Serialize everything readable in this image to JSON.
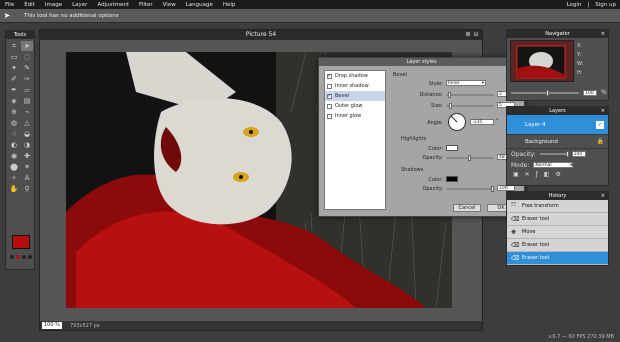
{
  "menu": [
    "File",
    "Edit",
    "Image",
    "Layer",
    "Adjustment",
    "Filter",
    "View",
    "Language",
    "Help"
  ],
  "account": {
    "login": "Login",
    "signup": "Sign up"
  },
  "infobar": {
    "text": "This tool has no additional options"
  },
  "tools_panel": {
    "title": "Tools"
  },
  "canvas": {
    "title": "Picture 54",
    "zoom": "100",
    "zoom_unit": "%",
    "dimensions": "793x527 px"
  },
  "dialog": {
    "title": "Layer styles",
    "effects": [
      {
        "label": "Drop shadow",
        "checked": true,
        "selected": false
      },
      {
        "label": "Inner shadow",
        "checked": false,
        "selected": false
      },
      {
        "label": "Bevel",
        "checked": true,
        "selected": true
      },
      {
        "label": "Outer glow",
        "checked": false,
        "selected": false
      },
      {
        "label": "Inner glow",
        "checked": false,
        "selected": false
      }
    ],
    "section": "Bevel",
    "style_label": "Style:",
    "style_value": "Inner",
    "distance_label": "Distance:",
    "distance_value": "2",
    "size_label": "Size:",
    "size_value": "5",
    "angle_label": "Angle:",
    "angle_value": "-135",
    "angle_unit": "°",
    "highlights_label": "Highlights",
    "hl_color_label": "Color:",
    "hl_color": "#ffffff",
    "hl_opacity_label": "Opacity:",
    "hl_opacity_value": "48",
    "shadows_label": "Shadows",
    "sh_color_label": "Color:",
    "sh_color": "#000000",
    "sh_opacity_label": "Opacity:",
    "sh_opacity_value": "100",
    "cancel": "Cancel",
    "ok": "OK"
  },
  "navigator": {
    "title": "Navigator",
    "x": "X:",
    "y": "Y:",
    "w": "W:",
    "h": "H:",
    "zoom": "100",
    "zoom_unit": "%"
  },
  "layers": {
    "title": "Layers",
    "items": [
      {
        "name": "Layer 4",
        "selected": true
      },
      {
        "name": "Background",
        "selected": false
      }
    ],
    "opacity_label": "Opacity:",
    "opacity_value": "100",
    "mode_label": "Mode:",
    "mode_value": "Normal"
  },
  "history": {
    "title": "History",
    "items": [
      {
        "label": "Free transform",
        "selected": false
      },
      {
        "label": "Eraser tool",
        "selected": false
      },
      {
        "label": "Move",
        "selected": false
      },
      {
        "label": "Eraser tool",
        "selected": false
      },
      {
        "label": "Eraser tool",
        "selected": true
      }
    ]
  },
  "version": "v.6.7 — 60 FPS 270.39 MB",
  "colors": {
    "accent": "#2f8fd8",
    "primary_swatch": "#b80d0d"
  }
}
